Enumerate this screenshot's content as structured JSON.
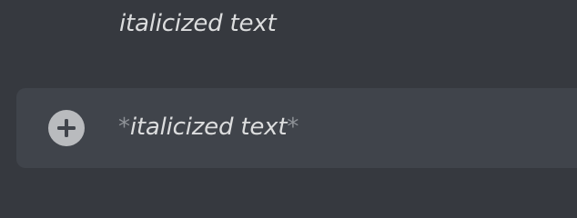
{
  "message": {
    "text": "italicized text"
  },
  "composer": {
    "attach_icon": "plus-circle-icon",
    "marker_open": "*",
    "input_text": "italicized text",
    "marker_close": "*"
  }
}
